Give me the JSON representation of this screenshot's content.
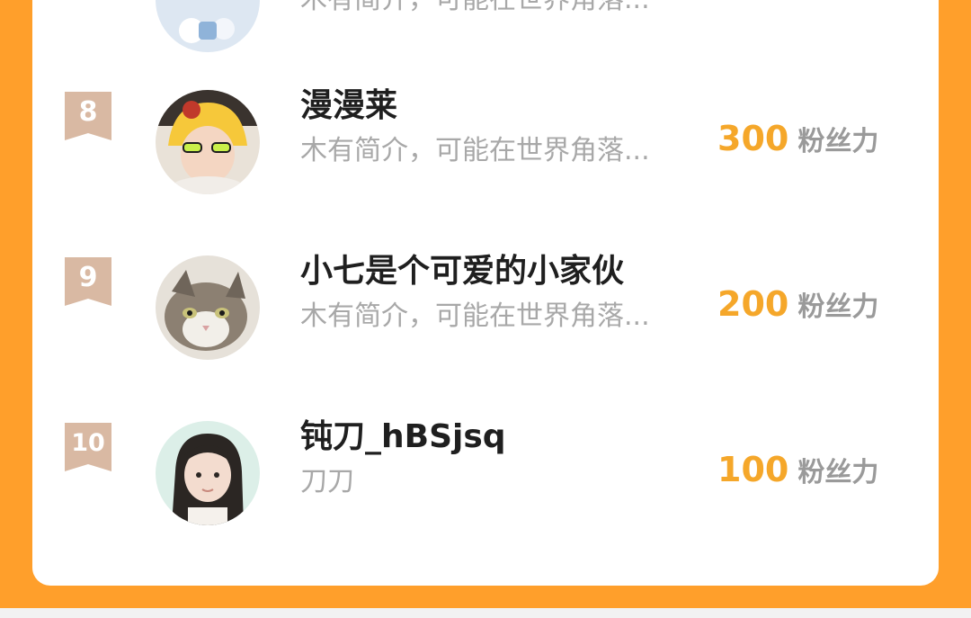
{
  "colors": {
    "frame": "#FF9F2B",
    "card": "#FFFFFF",
    "rank_badge": "#D9B9A3",
    "fans_number": "#F5A72A",
    "fans_unit": "#9A9A9A",
    "name": "#1F1F1F",
    "bio": "#A8A8A8"
  },
  "partial_top_row": {
    "bio": "木有简介，可能在世界角落..."
  },
  "ranking": [
    {
      "rank": "8",
      "name": "漫漫莱",
      "bio": "木有简介，可能在世界角落...",
      "fans": "300",
      "fans_unit": "粉丝力",
      "avatar": "child-with-sunglasses-avatar"
    },
    {
      "rank": "9",
      "name": "小七是个可爱的小家伙",
      "bio": "木有简介，可能在世界角落...",
      "fans": "200",
      "fans_unit": "粉丝力",
      "avatar": "cat-avatar"
    },
    {
      "rank": "10",
      "name": "钝刀_hBSjsq",
      "bio": "刀刀",
      "fans": "100",
      "fans_unit": "粉丝力",
      "avatar": "girl-avatar"
    }
  ]
}
